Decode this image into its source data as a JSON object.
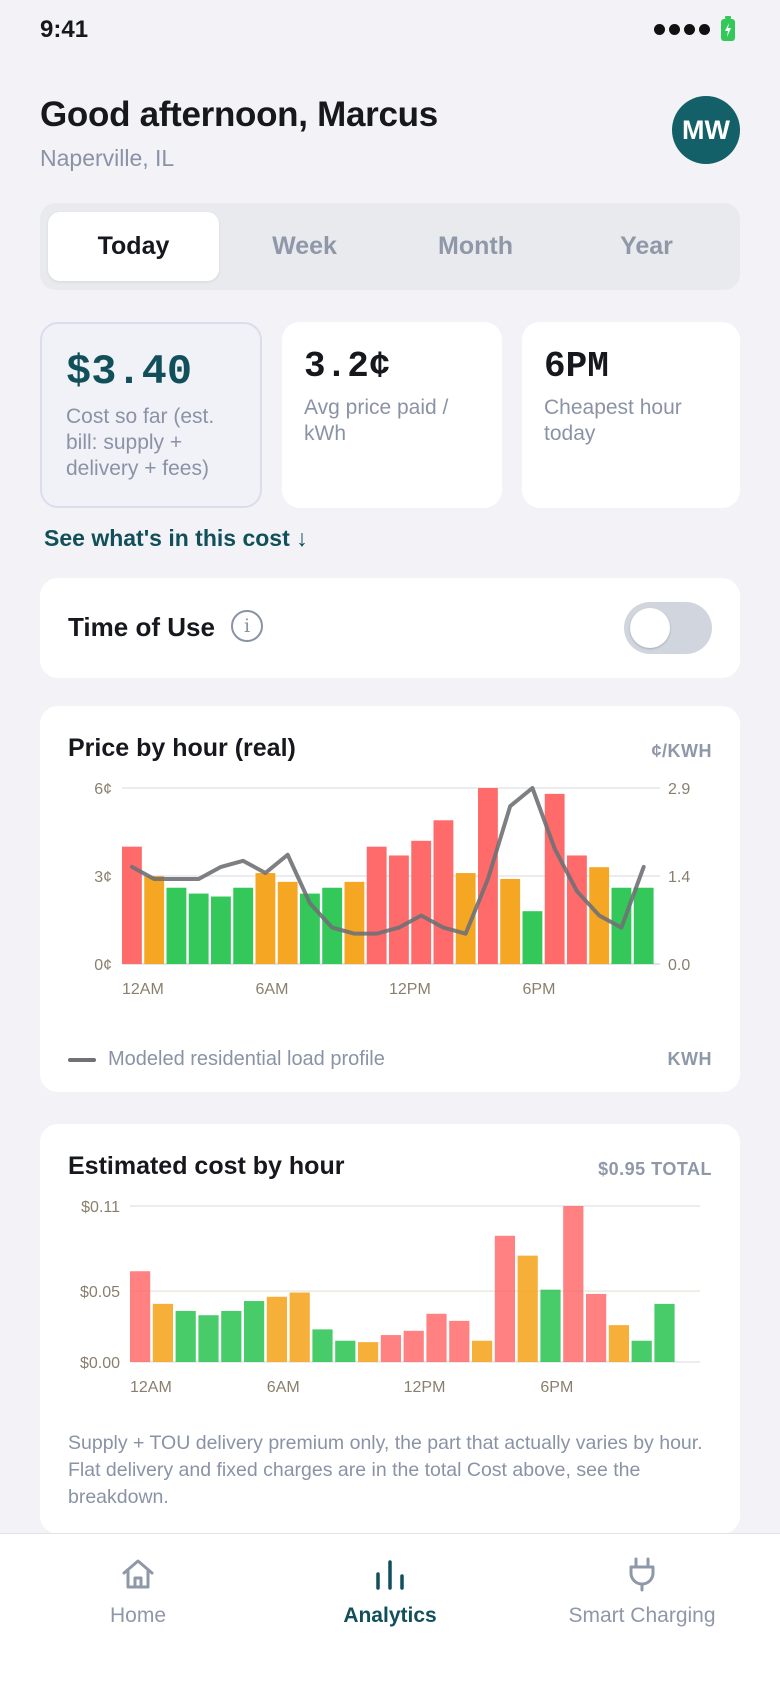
{
  "status_bar": {
    "time": "9:41"
  },
  "header": {
    "greeting": "Good afternoon, Marcus",
    "location": "Naperville, IL",
    "avatar_initials": "MW"
  },
  "tabs": [
    {
      "label": "Today",
      "active": true
    },
    {
      "label": "Week",
      "active": false
    },
    {
      "label": "Month",
      "active": false
    },
    {
      "label": "Year",
      "active": false
    }
  ],
  "stats": [
    {
      "value": "$3.40",
      "label": "Cost so far (est. bill: supply + delivery + fees)"
    },
    {
      "value": "3.2¢",
      "label": "Avg price paid / kWh"
    },
    {
      "value": "6PM",
      "label": "Cheapest hour today"
    }
  ],
  "see_cost_link": "See what's in this cost ↓",
  "time_of_use": {
    "label": "Time of Use",
    "enabled": false
  },
  "price_card": {
    "title": "Price by hour (real)",
    "unit_label": "¢/KWH",
    "legend_label": "Modeled residential load profile",
    "legend_unit": "KWH"
  },
  "cost_card": {
    "title": "Estimated cost by hour",
    "total_label": "$0.95 TOTAL",
    "note": "Supply + TOU delivery premium only, the part that actually varies by hour. Flat delivery and fixed charges are in the total Cost above, see the breakdown."
  },
  "nav": [
    {
      "label": "Home",
      "icon": "home-icon",
      "active": false
    },
    {
      "label": "Analytics",
      "icon": "analytics-icon",
      "active": true
    },
    {
      "label": "Smart Charging",
      "icon": "plug-icon",
      "active": false
    }
  ],
  "colors": {
    "high": "#ff6b6b",
    "mid": "#f5a623",
    "low": "#34c759",
    "line": "#6f7175",
    "accent": "#11505a"
  },
  "chart_data": [
    {
      "type": "bar",
      "title": "Price by hour (real)",
      "unit": "¢/KWH",
      "ylim": [
        0,
        6
      ],
      "y_ticks": [
        "0¢",
        "3¢",
        "6¢"
      ],
      "y2lim": [
        0,
        2.9
      ],
      "y2_ticks": [
        "0.0",
        "1.4",
        "2.9"
      ],
      "x_tick_labels": [
        "12AM",
        "6AM",
        "12PM",
        "6PM"
      ],
      "x_tick_hours": [
        0,
        6,
        12,
        18
      ],
      "categories": [
        "12AM",
        "1AM",
        "2AM",
        "3AM",
        "4AM",
        "5AM",
        "6AM",
        "7AM",
        "8AM",
        "9AM",
        "10AM",
        "11AM",
        "12PM",
        "1PM",
        "2PM",
        "3PM",
        "4PM",
        "5PM",
        "6PM",
        "7PM",
        "8PM",
        "9PM",
        "10PM",
        "11PM"
      ],
      "values": [
        4.0,
        3.0,
        2.6,
        2.4,
        2.3,
        2.6,
        3.1,
        2.8,
        2.4,
        2.6,
        2.8,
        4.0,
        3.7,
        4.2,
        4.9,
        3.1,
        6.0,
        2.9,
        1.8,
        5.8,
        3.7,
        3.3,
        2.6,
        2.6
      ],
      "levels": [
        "high",
        "mid",
        "low",
        "low",
        "low",
        "low",
        "mid",
        "mid",
        "low",
        "low",
        "mid",
        "high",
        "high",
        "high",
        "high",
        "mid",
        "high",
        "mid",
        "low",
        "high",
        "high",
        "mid",
        "low",
        "low"
      ],
      "series": [
        {
          "name": "Modeled residential load profile",
          "axis": "right",
          "values": [
            1.6,
            1.4,
            1.4,
            1.4,
            1.6,
            1.7,
            1.5,
            1.8,
            1.0,
            0.6,
            0.5,
            0.5,
            0.6,
            0.8,
            0.6,
            0.5,
            1.4,
            2.6,
            2.9,
            1.9,
            1.2,
            0.8,
            0.6,
            1.6
          ]
        }
      ],
      "grid": true
    },
    {
      "type": "bar",
      "title": "Estimated cost by hour",
      "total": "$0.95 TOTAL",
      "ylim": [
        0,
        0.11
      ],
      "y_ticks": [
        "$0.00",
        "$0.05",
        "$0.11"
      ],
      "x_tick_labels": [
        "12AM",
        "6AM",
        "12PM",
        "6PM"
      ],
      "x_tick_hours": [
        0,
        6,
        12,
        18
      ],
      "categories": [
        "12AM",
        "1AM",
        "2AM",
        "3AM",
        "4AM",
        "5AM",
        "6AM",
        "7AM",
        "8AM",
        "9AM",
        "10AM",
        "11AM",
        "12PM",
        "1PM",
        "2PM",
        "3PM",
        "4PM",
        "5PM",
        "6PM",
        "7PM",
        "8PM",
        "9PM",
        "10PM",
        "11PM",
        "12AM"
      ],
      "values": [
        0.064,
        0.041,
        0.036,
        0.033,
        0.036,
        0.043,
        0.046,
        0.049,
        0.023,
        0.015,
        0.014,
        0.019,
        0.022,
        0.034,
        0.029,
        0.015,
        0.089,
        0.075,
        0.051,
        0.11,
        0.048,
        0.026,
        0.015,
        0.041
      ],
      "levels": [
        "high",
        "mid",
        "low",
        "low",
        "low",
        "low",
        "mid",
        "mid",
        "low",
        "low",
        "mid",
        "high",
        "high",
        "high",
        "high",
        "mid",
        "high",
        "mid",
        "low",
        "high",
        "high",
        "mid",
        "low",
        "low"
      ],
      "grid": true
    }
  ]
}
